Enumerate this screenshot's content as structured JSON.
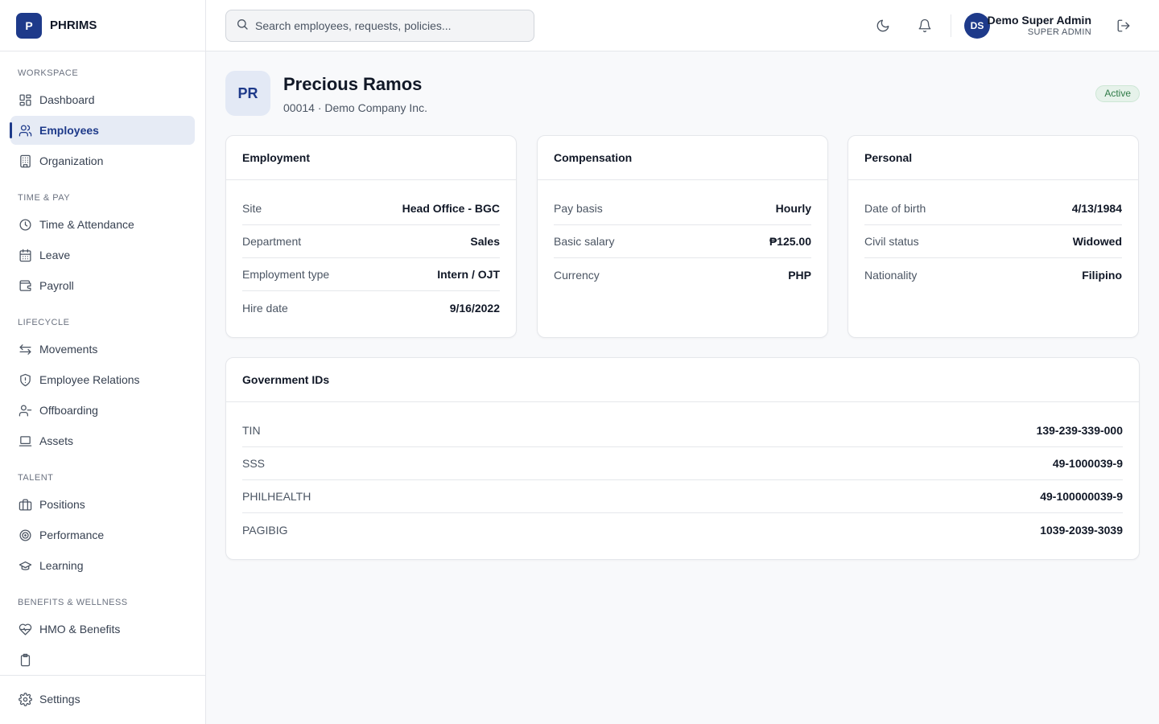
{
  "brand": {
    "logo_letter": "P",
    "name": "PHRIMS"
  },
  "sidebar": {
    "sections": [
      {
        "title": "WORKSPACE",
        "items": [
          {
            "label": "Dashboard",
            "icon": "dashboard-icon"
          },
          {
            "label": "Employees",
            "icon": "users-icon",
            "active": true
          },
          {
            "label": "Organization",
            "icon": "building-icon"
          }
        ]
      },
      {
        "title": "TIME & PAY",
        "items": [
          {
            "label": "Time & Attendance",
            "icon": "clock-icon"
          },
          {
            "label": "Leave",
            "icon": "calendar-icon"
          },
          {
            "label": "Payroll",
            "icon": "wallet-icon"
          }
        ]
      },
      {
        "title": "LIFECYCLE",
        "items": [
          {
            "label": "Movements",
            "icon": "arrows-icon"
          },
          {
            "label": "Employee Relations",
            "icon": "shield-icon"
          },
          {
            "label": "Offboarding",
            "icon": "user-minus-icon"
          },
          {
            "label": "Assets",
            "icon": "laptop-icon"
          }
        ]
      },
      {
        "title": "TALENT",
        "items": [
          {
            "label": "Positions",
            "icon": "briefcase-icon"
          },
          {
            "label": "Performance",
            "icon": "target-icon"
          },
          {
            "label": "Learning",
            "icon": "graduation-cap-icon"
          }
        ]
      },
      {
        "title": "BENEFITS & WELLNESS",
        "items": [
          {
            "label": "HMO & Benefits",
            "icon": "heart-pulse-icon"
          },
          {
            "label": "",
            "icon": "clipboard-icon"
          }
        ]
      }
    ],
    "footer": {
      "label": "Settings",
      "icon": "gear-icon"
    }
  },
  "header": {
    "search_placeholder": "Search employees, requests, policies...",
    "user": {
      "initials": "DS",
      "name": "Demo Super Admin",
      "role": "SUPER ADMIN"
    }
  },
  "profile": {
    "initials": "PR",
    "name": "Precious Ramos",
    "subtitle": "00014 · Demo Company Inc.",
    "status": "Active"
  },
  "employment": {
    "title": "Employment",
    "rows": [
      {
        "label": "Site",
        "value": "Head Office - BGC"
      },
      {
        "label": "Department",
        "value": "Sales"
      },
      {
        "label": "Employment type",
        "value": "Intern / OJT"
      },
      {
        "label": "Hire date",
        "value": "9/16/2022"
      }
    ]
  },
  "compensation": {
    "title": "Compensation",
    "rows": [
      {
        "label": "Pay basis",
        "value": "Hourly"
      },
      {
        "label": "Basic salary",
        "value": "₱125.00"
      },
      {
        "label": "Currency",
        "value": "PHP"
      }
    ]
  },
  "personal": {
    "title": "Personal",
    "rows": [
      {
        "label": "Date of birth",
        "value": "4/13/1984"
      },
      {
        "label": "Civil status",
        "value": "Widowed"
      },
      {
        "label": "Nationality",
        "value": "Filipino"
      }
    ]
  },
  "government_ids": {
    "title": "Government IDs",
    "rows": [
      {
        "label": "TIN",
        "value": "139-239-339-000"
      },
      {
        "label": "SSS",
        "value": "49-1000039-9"
      },
      {
        "label": "PHILHEALTH",
        "value": "49-100000039-9"
      },
      {
        "label": "PAGIBIG",
        "value": "1039-2039-3039"
      }
    ]
  },
  "colors": {
    "brand": "#1e3a8a",
    "active_bg": "#e6ebf5",
    "status_green": "#2f7a47"
  }
}
